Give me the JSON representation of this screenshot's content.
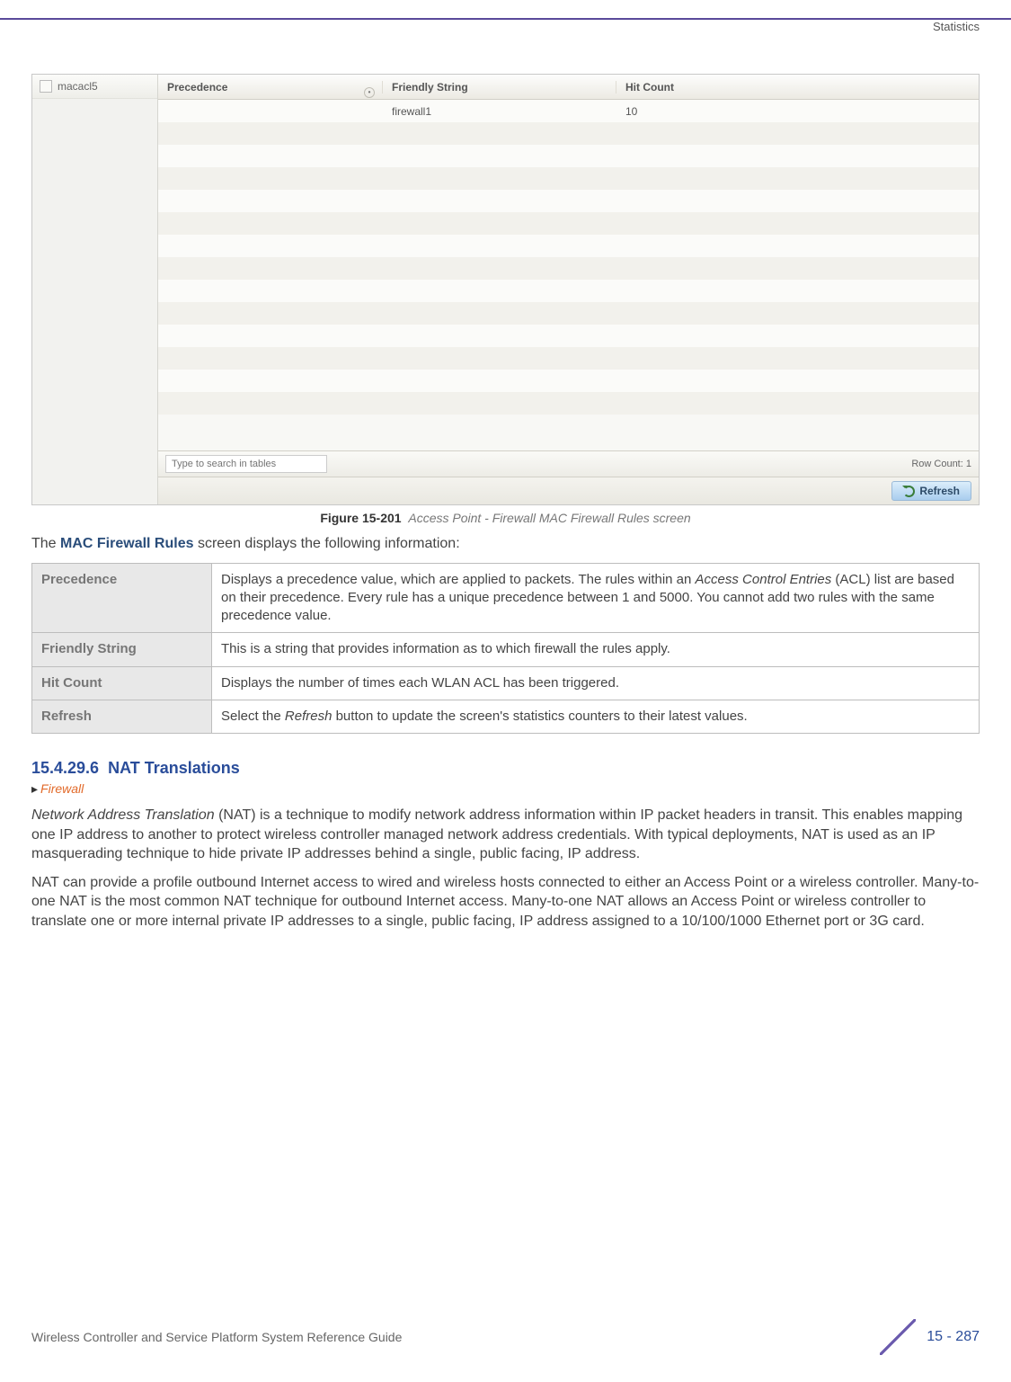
{
  "header": {
    "right_label": "Statistics"
  },
  "screenshot": {
    "sidebar_item": "macacl5",
    "columns": {
      "precedence": "Precedence",
      "friendly": "Friendly String",
      "hit": "Hit Count"
    },
    "rows": [
      {
        "precedence": "",
        "friendly": "firewall1",
        "hit": "10"
      }
    ],
    "search_placeholder": "Type to search in tables",
    "row_count_label": "Row Count:",
    "row_count_value": "1",
    "refresh_label": "Refresh"
  },
  "figure": {
    "number": "Figure 15-201",
    "caption": "Access Point - Firewall MAC Firewall Rules screen"
  },
  "intro": {
    "pre": "The ",
    "term": "MAC Firewall Rules",
    "post": " screen displays the following information:"
  },
  "def_table": [
    {
      "label": "Precedence",
      "desc_pre": "Displays a precedence value, which are applied to packets. The rules within an ",
      "desc_em": "Access Control Entries",
      "desc_post": " (ACL) list are based on their precedence. Every rule has a unique precedence between 1 and 5000. You cannot add two rules with the same precedence value."
    },
    {
      "label": "Friendly String",
      "desc_pre": "This is a string that provides information as to which firewall the rules apply.",
      "desc_em": "",
      "desc_post": ""
    },
    {
      "label": "Hit Count",
      "desc_pre": "Displays the number of times each WLAN ACL has been triggered.",
      "desc_em": "",
      "desc_post": ""
    },
    {
      "label": "Refresh",
      "desc_pre": "Select the ",
      "desc_em": "Refresh",
      "desc_post": " button to update the screen's statistics counters to their latest values."
    }
  ],
  "section": {
    "number": "15.4.29.6",
    "title": "NAT Translations",
    "breadcrumb_arrow": "▸",
    "breadcrumb": "Firewall"
  },
  "paragraphs": {
    "p1_em": "Network Address Translation",
    "p1_rest": " (NAT) is a technique to modify network address information within IP packet headers in transit. This enables mapping one IP address to another to protect wireless controller managed network address credentials. With typical deployments, NAT is used as an IP masquerading technique to hide private IP addresses behind a single, public facing, IP address.",
    "p2": "NAT can provide a profile outbound Internet access to wired and wireless hosts connected to either an Access Point or a wireless controller. Many-to-one NAT is the most common NAT technique for outbound Internet access. Many-to-one NAT allows an Access Point or wireless controller to translate one or more internal private IP addresses to a single, public facing, IP address assigned to a 10/100/1000 Ethernet port or 3G card."
  },
  "footer": {
    "guide": "Wireless Controller and Service Platform System Reference Guide",
    "page": "15 - 287"
  }
}
